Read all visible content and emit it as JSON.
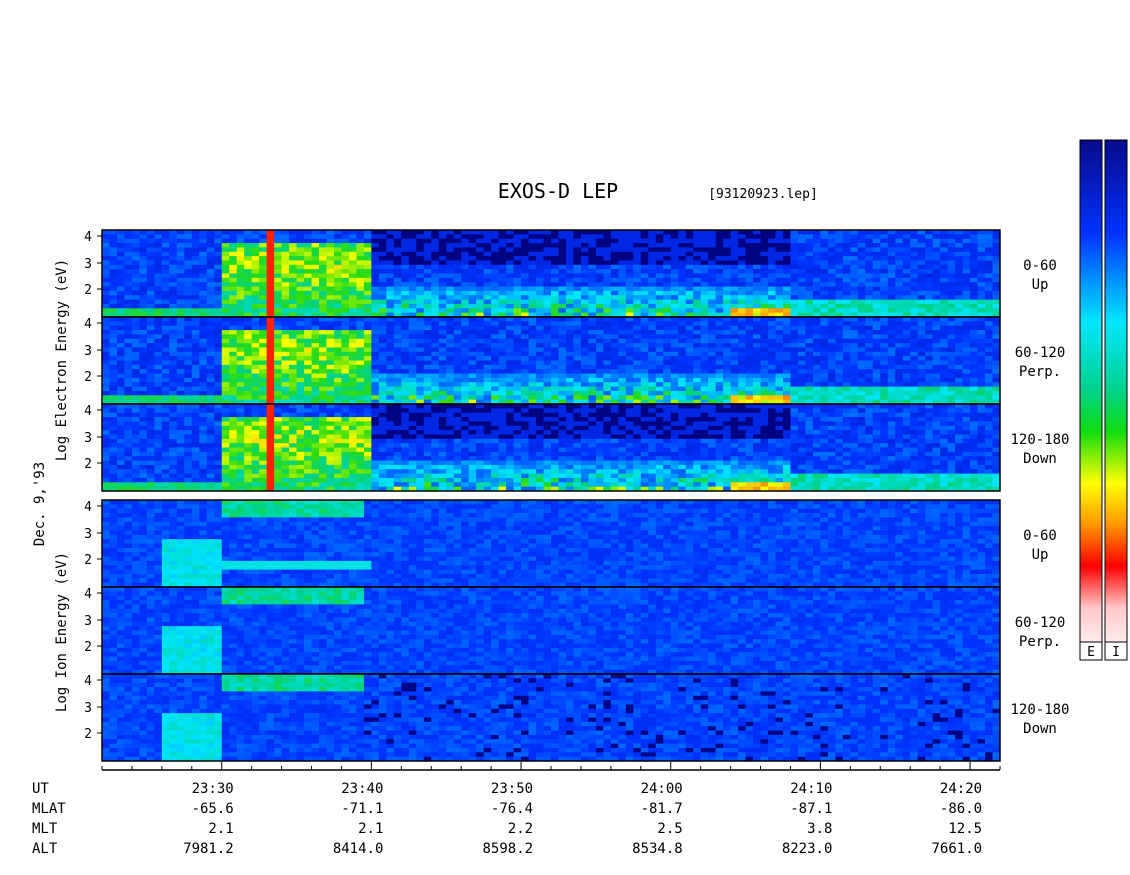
{
  "header": {
    "title": "EXOS-D LEP",
    "file": "[93120923.lep]"
  },
  "date_label": "Dec. 9,'93",
  "electron_axis_label": "Log Electron Energy (eV)",
  "ion_axis_label": "Log Ion Energy (eV)",
  "colorbar": {
    "labels": [
      "E",
      "I"
    ],
    "stops": [
      "#0a0a8c",
      "#0032ff",
      "#00e6ff",
      "#00d28c",
      "#10dc10",
      "#ffff00",
      "#ff9600",
      "#ff0000",
      "#ffc8c8",
      "#ffffff"
    ]
  },
  "ticks_legend": {
    "labels": [
      "UT",
      "MLAT",
      "MLT",
      "ALT"
    ]
  },
  "chart_data": {
    "type": "heatmap",
    "x_axis": {
      "quantity": "UT",
      "range": [
        "23:22",
        "24:22"
      ],
      "major_ticks": [
        "23:30",
        "23:40",
        "23:50",
        "24:00",
        "24:10",
        "24:20"
      ],
      "minor_tick_step_minutes": 2
    },
    "y_axis": {
      "scale": "log",
      "ticks": [
        "2",
        "3",
        "4"
      ]
    },
    "colorscale": "log intensity, blue (low) to red/white (high)",
    "ephemeris": {
      "UT": [
        "23:30",
        "23:40",
        "23:50",
        "24:00",
        "24:10",
        "24:20"
      ],
      "MLAT": [
        "-65.6",
        "-71.1",
        "-76.4",
        "-81.7",
        "-87.1",
        "-86.0"
      ],
      "MLT": [
        "2.1",
        "2.1",
        "2.2",
        "2.5",
        "3.8",
        "12.5"
      ],
      "ALT": [
        "7981.2",
        "8414.0",
        "8598.2",
        "8534.8",
        "8223.0",
        "7661.0"
      ]
    },
    "panels": [
      {
        "species": "Electron",
        "pitch": "0-60",
        "dir": "Up"
      },
      {
        "species": "Electron",
        "pitch": "60-120",
        "dir": "Perp."
      },
      {
        "species": "Electron",
        "pitch": "120-180",
        "dir": "Down"
      },
      {
        "species": "Ion",
        "pitch": "0-60",
        "dir": "Up"
      },
      {
        "species": "Ion",
        "pitch": "60-120",
        "dir": "Perp."
      },
      {
        "species": "Ion",
        "pitch": "120-180",
        "dir": "Down"
      }
    ]
  }
}
